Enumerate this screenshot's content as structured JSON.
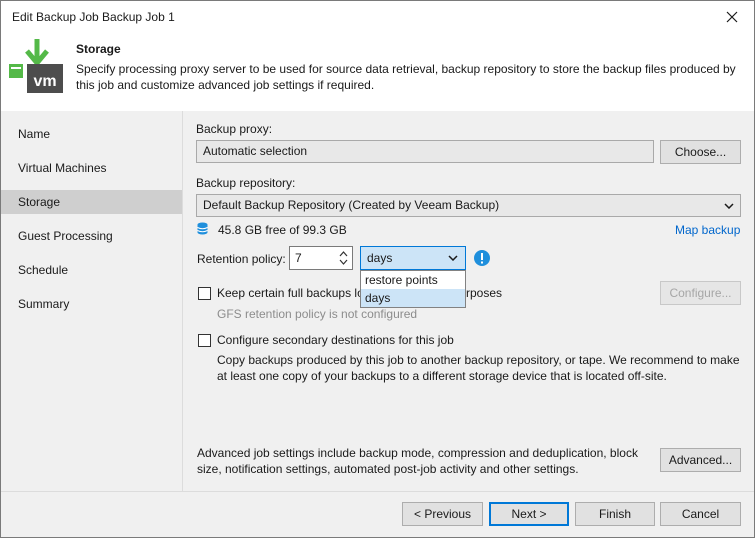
{
  "window": {
    "title": "Edit Backup Job Backup Job 1"
  },
  "header": {
    "title": "Storage",
    "description": "Specify processing proxy server to be used for source data retrieval, backup repository to store the backup files produced by this job and customize advanced job settings if required.",
    "icon_text": "vm"
  },
  "sidebar": {
    "items": [
      {
        "label": "Name"
      },
      {
        "label": "Virtual Machines"
      },
      {
        "label": "Storage"
      },
      {
        "label": "Guest Processing"
      },
      {
        "label": "Schedule"
      },
      {
        "label": "Summary"
      }
    ]
  },
  "storage": {
    "proxy_label": "Backup proxy:",
    "proxy_value": "Automatic selection",
    "choose_label": "Choose...",
    "repo_label": "Backup repository:",
    "repo_value": "Default Backup Repository (Created by Veeam Backup)",
    "free_space": "45.8 GB free of 99.3 GB",
    "map_backup_label": "Map backup",
    "retention_label": "Retention policy:",
    "retention_value": "7",
    "retention_unit": "days",
    "unit_options": [
      "restore points",
      "days"
    ],
    "keep_full_label_left": "Keep certain full backups lo",
    "keep_full_label_right": "rposes",
    "gfs_note": "GFS retention policy is not configured",
    "configure_label": "Configure...",
    "secondary_label": "Configure secondary destinations for this job",
    "secondary_desc": "Copy backups produced by this job to another backup repository, or tape. We recommend to make at least one copy of your backups to a different storage device that is located off-site.",
    "advanced_desc": "Advanced job settings include backup mode, compression and deduplication, block size, notification settings, automated post-job activity and other settings.",
    "advanced_label": "Advanced..."
  },
  "footer": {
    "previous_label": "< Previous",
    "next_label": "Next >",
    "finish_label": "Finish",
    "cancel_label": "Cancel"
  },
  "colors": {
    "accent": "#0078d7",
    "link": "#0066cc",
    "veeam_green": "#54b948",
    "info": "#1f8fdc"
  }
}
